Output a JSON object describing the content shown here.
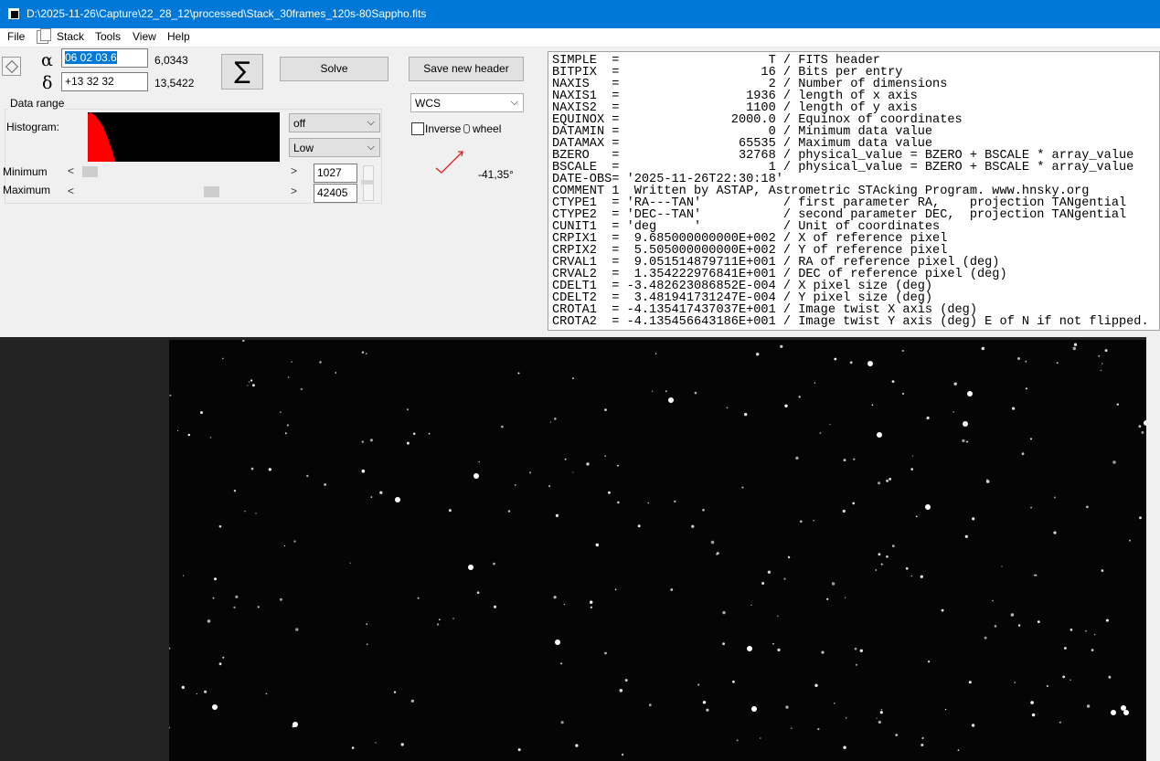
{
  "window": {
    "title": "D:\\2025-11-26\\Capture\\22_28_12\\processed\\Stack_30frames_120s-80Sappho.fits"
  },
  "menu": {
    "file": "File",
    "stack": "Stack",
    "tools": "Tools",
    "view": "View",
    "help": "Help"
  },
  "coords": {
    "alpha_symbol": "α",
    "alpha_value": "06 02 03.6",
    "alpha_decimal": "6,0343",
    "delta_symbol": "δ",
    "delta_value": "+13 32 32",
    "delta_decimal": "13,5422"
  },
  "buttons": {
    "sigma": "∑",
    "solve": "Solve",
    "save_header": "Save new header"
  },
  "wcs_select": "WCS",
  "data_range": {
    "group_label": "Data range",
    "histogram_label": "Histogram:",
    "mode_select": "off",
    "level_select": "Low",
    "minimum_label": "Minimum",
    "maximum_label": "Maximum",
    "minimum_value": "1027",
    "maximum_value": "42405"
  },
  "inverse": {
    "label": "Inverse",
    "wheel_label": "wheel",
    "checked": false
  },
  "angle": "-41,35°",
  "fits_header": [
    "SIMPLE  =                    T / FITS header",
    "BITPIX  =                   16 / Bits per entry",
    "NAXIS   =                    2 / Number of dimensions",
    "NAXIS1  =                 1936 / length of x axis",
    "NAXIS2  =                 1100 / length of y axis",
    "EQUINOX =               2000.0 / Equinox of coordinates",
    "DATAMIN =                    0 / Minimum data value",
    "DATAMAX =                65535 / Maximum data value",
    "BZERO   =                32768 / physical_value = BZERO + BSCALE * array_value",
    "BSCALE  =                    1 / physical_value = BZERO + BSCALE * array_value",
    "DATE-OBS= '2025-11-26T22:30:18'",
    "COMMENT 1  Written by ASTAP, Astrometric STAcking Program. www.hnsky.org",
    "CTYPE1  = 'RA---TAN'           / first parameter RA,    projection TANgential",
    "CTYPE2  = 'DEC--TAN'           / second parameter DEC,  projection TANgential",
    "CUNIT1  = 'deg     '           / Unit of coordinates",
    "CRPIX1  =  9.685000000000E+002 / X of reference pixel",
    "CRPIX2  =  5.505000000000E+002 / Y of reference pixel",
    "CRVAL1  =  9.051514879711E+001 / RA of reference pixel (deg)",
    "CRVAL2  =  1.354222976841E+001 / DEC of reference pixel (deg)",
    "CDELT1  = -3.482623086852E-004 / X pixel size (deg)",
    "CDELT2  =  3.481941731247E-004 / Y pixel size (deg)",
    "CROTA1  = -4.135417437037E+001 / Image twist X axis (deg)",
    "CROTA2  = -4.135456643186E+001 / Image twist Y axis (deg) E of N if not flipped."
  ],
  "icons": {
    "app": "app-icon",
    "stack_menu": "stack-icon",
    "orient": "orientation-icon",
    "mouse": "mouse-icon",
    "arrow": "orientation-arrow-icon"
  },
  "colors": {
    "titlebar": "#0078d7",
    "histogram": "#ff0000",
    "selection": "#0078d7",
    "arrow": "#e02020"
  }
}
